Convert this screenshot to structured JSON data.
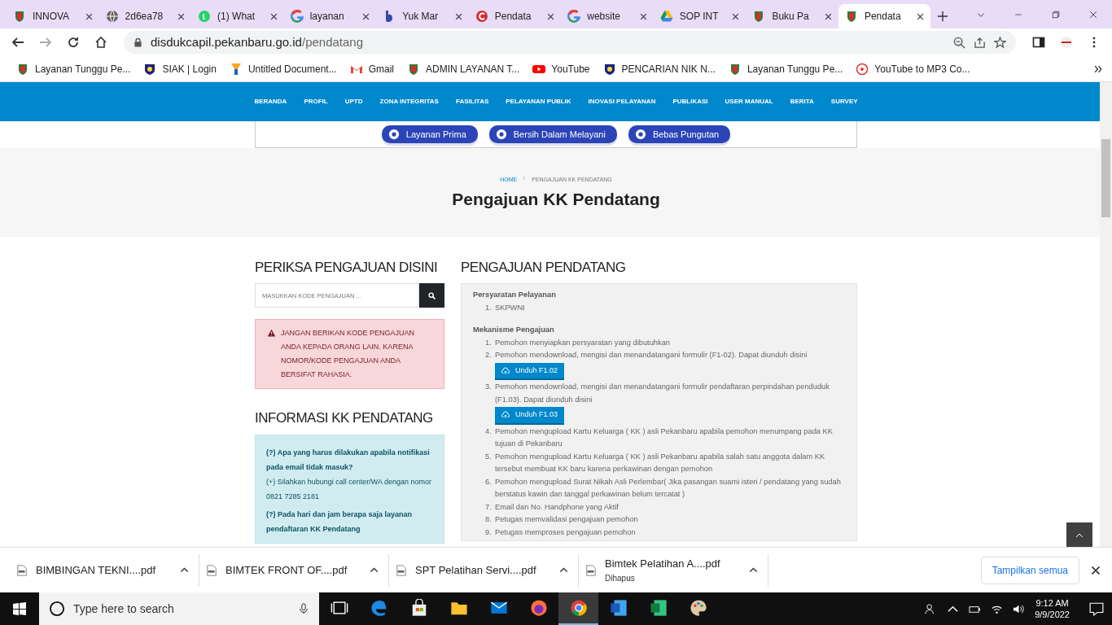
{
  "browser": {
    "tabs": [
      {
        "title": "INNOVA",
        "selected": false
      },
      {
        "title": "2d6ea78",
        "selected": false
      },
      {
        "title": "(1) What",
        "selected": false
      },
      {
        "title": "layanan",
        "selected": false
      },
      {
        "title": "Yuk Mar",
        "selected": false
      },
      {
        "title": "Pendata",
        "selected": false
      },
      {
        "title": "website",
        "selected": false
      },
      {
        "title": "SOP INT",
        "selected": false
      },
      {
        "title": "Buku Pa",
        "selected": false
      },
      {
        "title": "Pendata",
        "selected": true
      }
    ],
    "address": {
      "domain": "disdukcapil.pekanbaru.go.id",
      "path": "/pendatang"
    },
    "bookmarks": [
      "Layanan Tunggu Pe...",
      "SIAK | Login",
      "Untitled Document...",
      "Gmail",
      "ADMIN LAYANAN T...",
      "YouTube",
      "PENCARIAN NIK N...",
      "Layanan Tunggu Pe...",
      "YouTube to MP3 Co..."
    ]
  },
  "site": {
    "nav": [
      "BERANDA",
      "PROFIL",
      "UPTD",
      "ZONA INTEGRITAS",
      "FASILITAS",
      "PELAYANAN PUBLIK",
      "INOVASI PELAYANAN",
      "PUBLIKASI",
      "USER MANUAL",
      "BERITA",
      "SURVEY"
    ],
    "banner_pills": [
      "Layanan Prima",
      "Bersih Dalam Melayani",
      "Bebas Pungutan"
    ],
    "breadcrumb": [
      {
        "label": "HOME",
        "kind": "link"
      },
      {
        "label": "PENGAJUAN KK PENDATANG",
        "kind": "current"
      }
    ],
    "page_title": "Pengajuan KK Pendatang",
    "sidebar": {
      "check_heading": "PERIKSA PENGAJUAN DISINI",
      "search": {
        "placeholder": "MASUKKAN KODE PENGAJUAN ..."
      },
      "warning": "JANGAN BERIKAN KODE PENGAJUAN ANDA KEPADA ORANG LAIN. KARENA NOMOR/KODE PENGAJUAN ANDA BERSIFAT RAHASIA.",
      "info_heading": "INFORMASI KK PENDATANG",
      "faq": [
        {
          "kind": "question",
          "text": "(?) Apa yang harus dilakukan apabila notifikasi pada email tidak masuk?"
        },
        {
          "kind": "answer",
          "text": "(+) Silahkan hubungi call center/WA dengan nomor 0821 7285 2181"
        },
        {
          "kind": "question",
          "text": "(?) Pada hari dan jam berapa saja layanan pendaftaran KK Pendatang"
        }
      ]
    },
    "main": {
      "heading": "PENGAJUAN PENDATANG",
      "sections": [
        {
          "title": "Persyaratan Pelayanan",
          "items": [
            {
              "number": "1.",
              "text": "SKPWNI"
            }
          ]
        },
        {
          "title": "Mekanisme Pengajuan",
          "items": [
            {
              "number": "1.",
              "text": "Pemohon menyiapkan persyaratan yang dibutuhkan"
            },
            {
              "number": "2.",
              "text": "Pemohon mendownload, mengisi dan menandatangani formulir (F1-02). Dapat diunduh disini",
              "button": "Unduh F1.02"
            },
            {
              "number": "3.",
              "text": "Pemohon mendownload, mengisi dan menandatangani formulir pendaftaran perpindahan penduduk (F1.03). Dapat diunduh disini",
              "button": "Unduh F1.03"
            },
            {
              "number": "4.",
              "text": "Pemohon mengupload Kartu Keluarga ( KK ) asli Pekanbaru apabila pemohon menumpang pada KK tujuan di Pekanbaru"
            },
            {
              "number": "5.",
              "text": "Pemohon mengupload Kartu Keluarga ( KK ) asli Pekanbaru apabila salah satu anggota dalam KK tersebut membuat KK baru karena perkawinan dengan pemohon"
            },
            {
              "number": "6.",
              "text": "Pemohon mengupload Surat Nikah Asli Perlembar( Jika pasangan suami isteri / pendatang yang sudah berstatus kawin dan tanggal perkawinan belum tercatat )"
            },
            {
              "number": "7.",
              "text": "Email dan No. Handphone yang Aktif"
            },
            {
              "number": "8.",
              "text": "Petugas memvalidasi pengajuan pemohon"
            },
            {
              "number": "9.",
              "text": "Petugas memproses pengajuan pemohon"
            }
          ]
        }
      ]
    }
  },
  "downloads": {
    "items": [
      {
        "name": "BIMBINGAN TEKNI....pdf"
      },
      {
        "name": "BIMTEK FRONT OF....pdf"
      },
      {
        "name": "SPT Pelatihan Servi....pdf"
      },
      {
        "name": "Bimtek Pelatihan A....pdf",
        "status": "Dihapus"
      }
    ],
    "show_all": "Tampilkan semua"
  },
  "taskbar": {
    "search_placeholder": "Type here to search",
    "apps": [
      {
        "active": false
      },
      {
        "active": false
      },
      {
        "active": false
      },
      {
        "active": false
      },
      {
        "active": false
      },
      {
        "active": false
      },
      {
        "active": true
      },
      {
        "active": false
      },
      {
        "active": false
      },
      {
        "active": false
      }
    ],
    "time": "9:12 AM",
    "date": "9/9/2022"
  }
}
